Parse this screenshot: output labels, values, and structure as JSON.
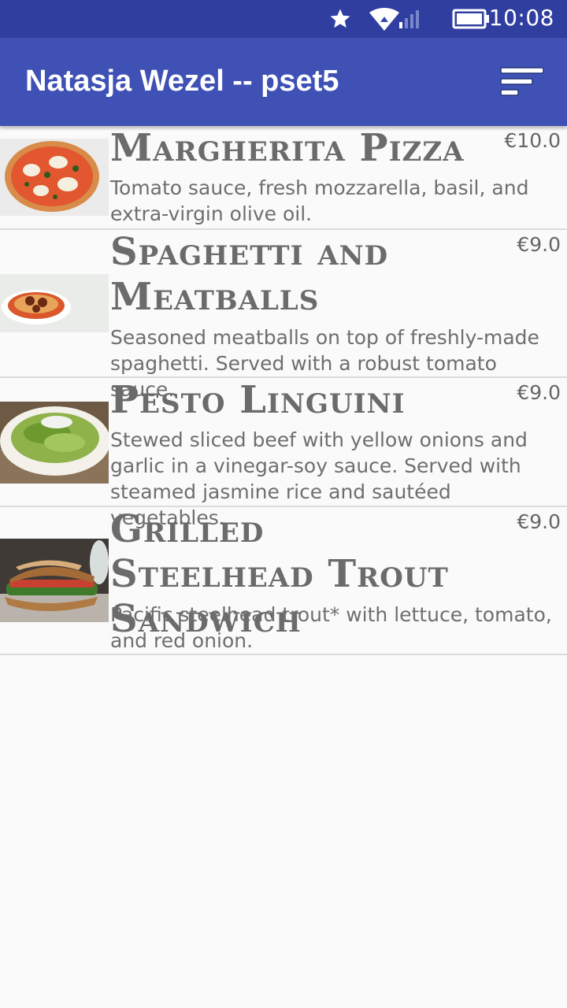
{
  "status_bar": {
    "time": "10:08",
    "icons": [
      "star-icon",
      "wifi-icon",
      "signal-icon",
      "battery-icon"
    ]
  },
  "app_bar": {
    "title": "Natasja Wezel -- pset5",
    "action_icon": "sort-icon"
  },
  "colors": {
    "status_bar": "#303f9f",
    "app_bar": "#3f51b5",
    "background": "#fafafa",
    "text": "#6e6e6e"
  },
  "menu_items": [
    {
      "title": "Margherita Pizza",
      "price": "€10.0",
      "description": "Tomato sauce, fresh mozzarella, basil, and extra-virgin olive oil.",
      "image": "pizza-photo"
    },
    {
      "title": "Spaghetti and Meatballs",
      "price": "€9.0",
      "description": "Seasoned meatballs on top of freshly-made spaghetti. Served with a robust tomato sauce.",
      "image": "spaghetti-photo"
    },
    {
      "title": "Pesto Linguini",
      "price": "€9.0",
      "description": "Stewed sliced beef with yellow onions and garlic in a vinegar-soy sauce. Served with steamed jasmine rice and sautéed vegetables.",
      "image": "pesto-photo"
    },
    {
      "title": "Grilled Steelhead Trout Sandwich",
      "price": "€9.0",
      "description": "Pacific steelhead trout* with lettuce, tomato, and red onion.",
      "image": "sandwich-photo"
    }
  ]
}
